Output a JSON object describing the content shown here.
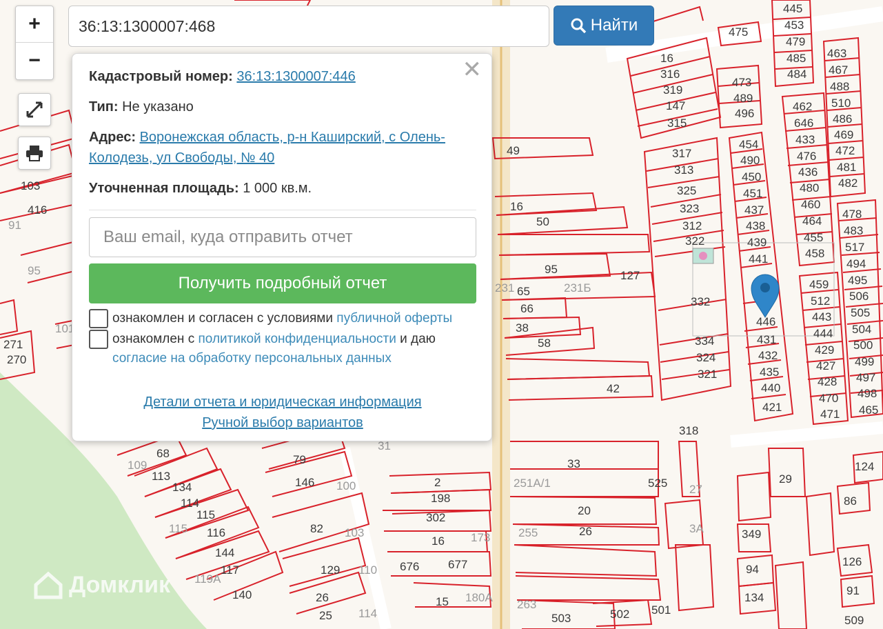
{
  "search": {
    "value": "36:13:1300007:468",
    "button_label": "Найти"
  },
  "zoom": {
    "in_label": "+",
    "out_label": "−"
  },
  "popup": {
    "cadastral_label": "Кадастровый номер:",
    "cadastral_value": "36:13:1300007:446",
    "type_label": "Тип:",
    "type_value": "Не указано",
    "address_label": "Адрес:",
    "address_value": "Воронежская область, р-н Каширский, с Олень-Колодезь, ул Свободы, № 40",
    "area_label": "Уточненная площадь:",
    "area_value": "1 000 кв.м.",
    "email_placeholder": "Ваш email, куда отправить отчет",
    "report_button": "Получить подробный отчет",
    "consent1_text": "ознакомлен и согласен с условиями",
    "consent1_link": "публичной оферты",
    "consent2_text": "ознакомлен с",
    "consent2_link": "политикой конфиденциальности",
    "consent2_mid": "и даю",
    "consent2_link2": "согласие на обработку персональных данных",
    "details_link": "Детали отчета и юридическая информация",
    "manual_link": "Ручной выбор вариантов"
  },
  "watermark": "Домклик",
  "colors": {
    "parcel_border": "#d8222b",
    "accent_blue": "#337ab7",
    "report_green": "#5cb85c",
    "road": "#f3ead0",
    "forest": "#cfe9c3"
  },
  "icons": [
    "zoom-in-icon",
    "zoom-out-icon",
    "fullscreen-icon",
    "print-icon",
    "search-icon",
    "close-icon",
    "map-pin-icon"
  ]
}
